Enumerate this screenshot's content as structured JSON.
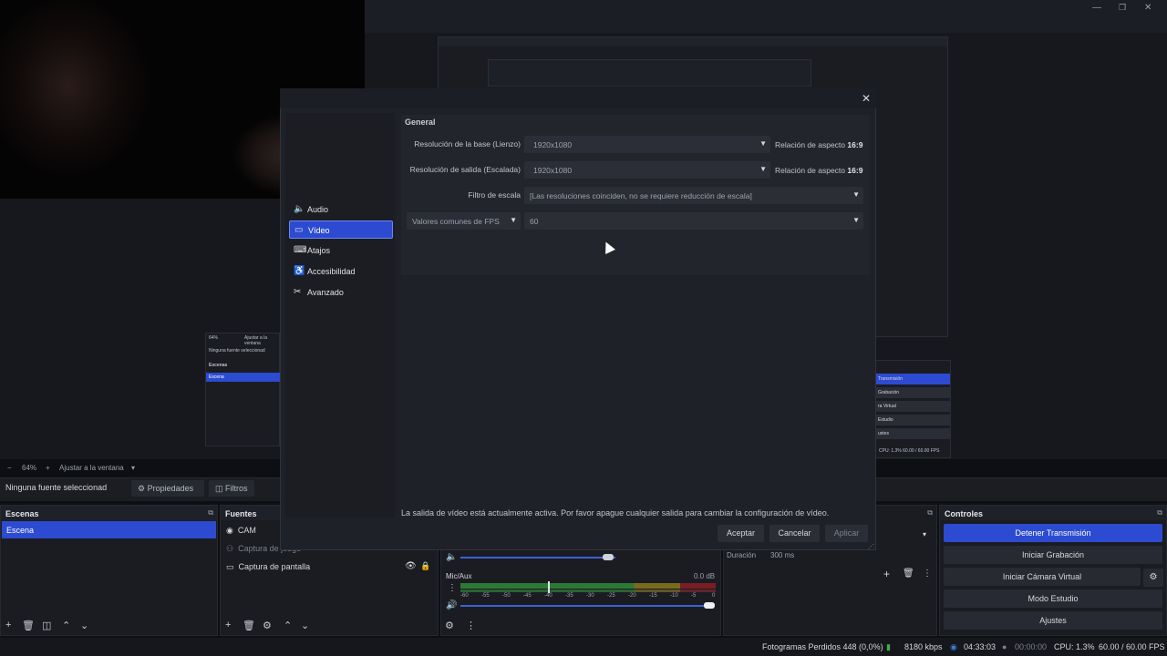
{
  "window": {
    "min_icon": "—",
    "max_icon": "❐",
    "close_icon": "✕"
  },
  "echo": {
    "scenes_title": "Escenas",
    "scene_item": "Escena",
    "no_source": "Ninguna fuente seleccionad",
    "zoom": "64%",
    "fit": "Ajustar a la ventana",
    "controls": [
      "Transmisión",
      "Grabación",
      "ra Virtual",
      "Estudio",
      "ustes"
    ],
    "status": "CPU: 1.3%   60.00 / 60.00 FPS"
  },
  "zoombar": {
    "minus": "−",
    "zoom": "64%",
    "plus": "+",
    "fit": "Ajustar a la ventana",
    "caret": "▾"
  },
  "source_toolbar": {
    "no_source": "Ninguna fuente seleccionad",
    "properties": "Propiedades",
    "filters": "Filtros"
  },
  "scenes": {
    "title": "Escenas",
    "items": [
      "Escena"
    ]
  },
  "sources": {
    "title": "Fuentes",
    "items": [
      "CAM",
      "Captura de juego",
      "Captura de pantalla"
    ]
  },
  "mixer": {
    "device": "Mic/Aux",
    "db": "0.0 dB",
    "ticks": [
      "-60",
      "-55",
      "-50",
      "-45",
      "-40",
      "-35",
      "-30",
      "-25",
      "-20",
      "-15",
      "-10",
      "-5",
      "0"
    ]
  },
  "transitions": {
    "duration_label": "Duración",
    "duration_value": "300 ms"
  },
  "controls": {
    "title": "Controles",
    "stop_stream": "Detener Transmisión",
    "start_record": "Iniciar Grabación",
    "start_vcam": "Iniciar Cámara Virtual",
    "studio_mode": "Modo Estudio",
    "settings": "Ajustes"
  },
  "statusbar": {
    "dropped": "Fotogramas Perdidos 448 (0,0%)",
    "bitrate": "8180 kbps",
    "stream_time": "04:33:03",
    "record_time": "00:00:00",
    "cpu": "CPU: 1.3%",
    "fps": "60.00 / 60.00 FPS"
  },
  "dialog": {
    "close_icon": "✕",
    "nav": [
      {
        "label": "Audio",
        "icon": "🔈"
      },
      {
        "label": "Vídeo",
        "icon": "▭"
      },
      {
        "label": "Atajos",
        "icon": "⌨"
      },
      {
        "label": "Accesibilidad",
        "icon": "♿"
      },
      {
        "label": "Avanzado",
        "icon": "✂"
      }
    ],
    "group_title": "General",
    "base_res_label": "Resolución de la base (Lienzo)",
    "base_res_value": "1920x1080",
    "output_res_label": "Resolución de salida (Escalada)",
    "output_res_value": "1920x1080",
    "aspect_label": "Relación de aspecto",
    "aspect_value": "16:9",
    "filter_label": "Filtro de escala",
    "filter_value": "[Las resoluciones coinciden, no se requiere reducción de escala]",
    "fps_type": "Valores comunes de FPS",
    "fps_value": "60",
    "warning": "La salida de vídeo está actualmente activa. Por favor apague cualquier salida para cambiar la configuración de vídeo.",
    "ok": "Aceptar",
    "cancel": "Cancelar",
    "apply": "Aplicar"
  },
  "colors": {
    "accent": "#2d4bd1",
    "background": "#1f2128"
  }
}
